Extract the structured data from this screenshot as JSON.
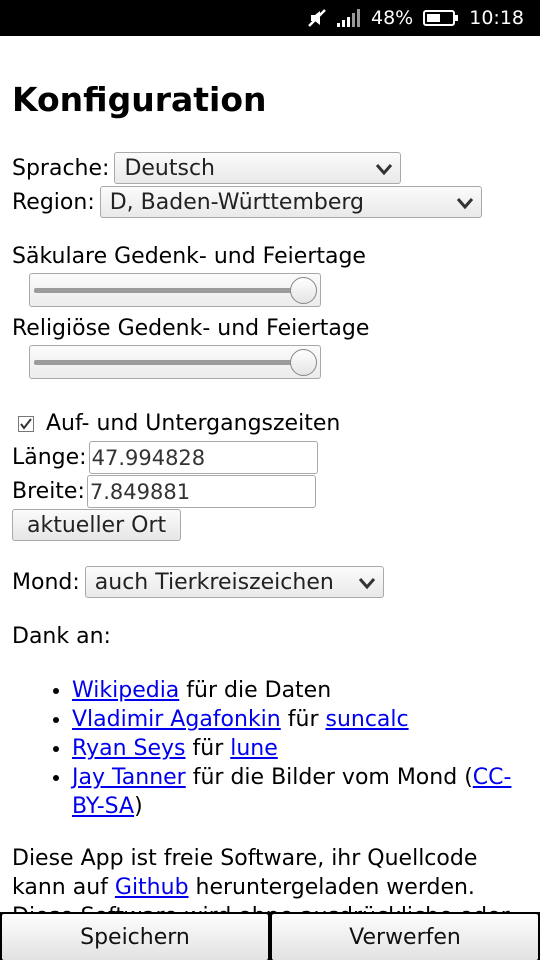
{
  "status": {
    "battery_percent": "48%",
    "time": "10:18"
  },
  "title": "Konfiguration",
  "language": {
    "label": "Sprache:",
    "value": "Deutsch"
  },
  "region": {
    "label": "Region:",
    "value": "D, Baden-Württemberg"
  },
  "secular": {
    "label": "Säkulare Gedenk- und Feiertage",
    "level": 1.0
  },
  "religious": {
    "label": "Religiöse Gedenk- und Feiertage",
    "level": 1.0
  },
  "sun": {
    "label": "Auf- und Untergangszeiten",
    "checked": true
  },
  "longitude": {
    "label": "Länge:",
    "value": "47.994828"
  },
  "latitude": {
    "label": "Breite:",
    "value": "7.849881"
  },
  "current_location_button": "aktueller Ort",
  "moon": {
    "label": "Mond:",
    "value": "auch Tierkreiszeichen"
  },
  "thanks": {
    "heading": "Dank an:",
    "items": [
      {
        "link": "Wikipedia",
        "text": "für die Daten"
      },
      {
        "link": "Vladimir Agafonkin",
        "text": "für",
        "link2": "suncalc"
      },
      {
        "link": "Ryan Seys",
        "text": "für",
        "link2": "lune"
      },
      {
        "link": "Jay Tanner",
        "text": "für die Bilder vom Mond",
        "open": "(",
        "link2": "CC-BY-SA",
        "close": ")"
      }
    ]
  },
  "about": {
    "text1": "Diese App ist freie Software, ihr Quellcode kann auf",
    "link": "Github",
    "text2": "heruntergeladen werden.",
    "text3": "Diese Software wird ohne ausdrückliche oder"
  },
  "buttons": {
    "save": "Speichern",
    "discard": "Verwerfen"
  }
}
